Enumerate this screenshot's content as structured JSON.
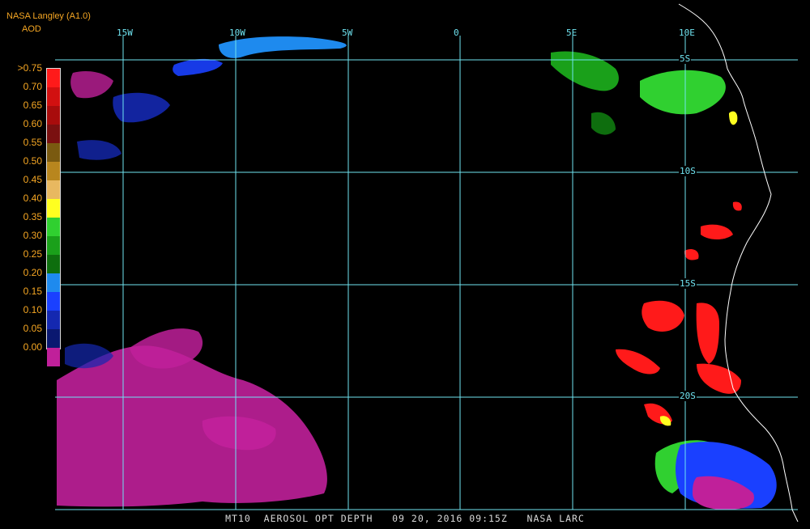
{
  "header": {
    "source": "NASA Langley (A1.0)",
    "product": "AOD"
  },
  "legend": {
    "labels": [
      ">0.75",
      "0.70",
      "0.65",
      "0.60",
      "0.55",
      "0.50",
      "0.45",
      "0.40",
      "0.35",
      "0.30",
      "0.25",
      "0.20",
      "0.15",
      "0.10",
      "0.05",
      "0.00"
    ],
    "colors": [
      "#ff1a1a",
      "#d21010",
      "#a80c0c",
      "#7a1010",
      "#7a5a10",
      "#b8861e",
      "#e8b860",
      "#ffff20",
      "#30d030",
      "#1aa01a",
      "#0e6e0e",
      "#1e8aee",
      "#1a40ff",
      "#1428b0",
      "#0a1870",
      "#c0209a"
    ]
  },
  "grid": {
    "lon_labels": [
      "15W",
      "10W",
      "5W",
      "0",
      "5E",
      "10E"
    ],
    "lat_labels": [
      "5S",
      "10S",
      "15S",
      "20S"
    ]
  },
  "footer": "MT10  AEROSOL OPT DEPTH   09 20, 2016 09:15Z   NASA LARC",
  "colors": {
    "grid": "#6fe3f0",
    "coast": "#ffffff",
    "label": "#f5a623",
    "aod_low": "#c0209a",
    "aod_blue": "#1a40ff",
    "aod_green": "#30d030",
    "aod_red": "#ff1a1a"
  }
}
